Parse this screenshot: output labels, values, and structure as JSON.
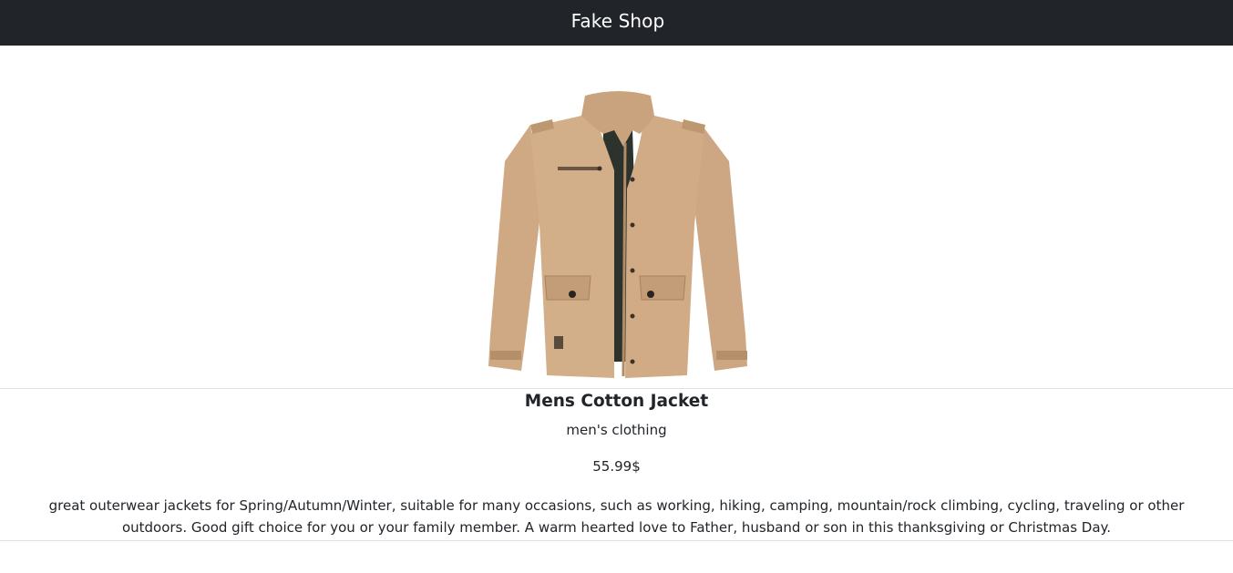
{
  "navbar": {
    "brand": "Fake Shop"
  },
  "product": {
    "image_icon": "jacket-image",
    "title": "Mens Cotton Jacket",
    "category": "men's clothing",
    "price": "55.99$",
    "description": "great outerwear jackets for Spring/Autumn/Winter, suitable for many occasions, such as working, hiking, camping, mountain/rock climbing, cycling, traveling or other outdoors. Good gift choice for you or your family member. A warm hearted love to Father, husband or son in this thanksgiving or Christmas Day."
  },
  "colors": {
    "navbar_bg": "#212529",
    "jacket": "#d0ad88",
    "lining": "#2c322c"
  }
}
